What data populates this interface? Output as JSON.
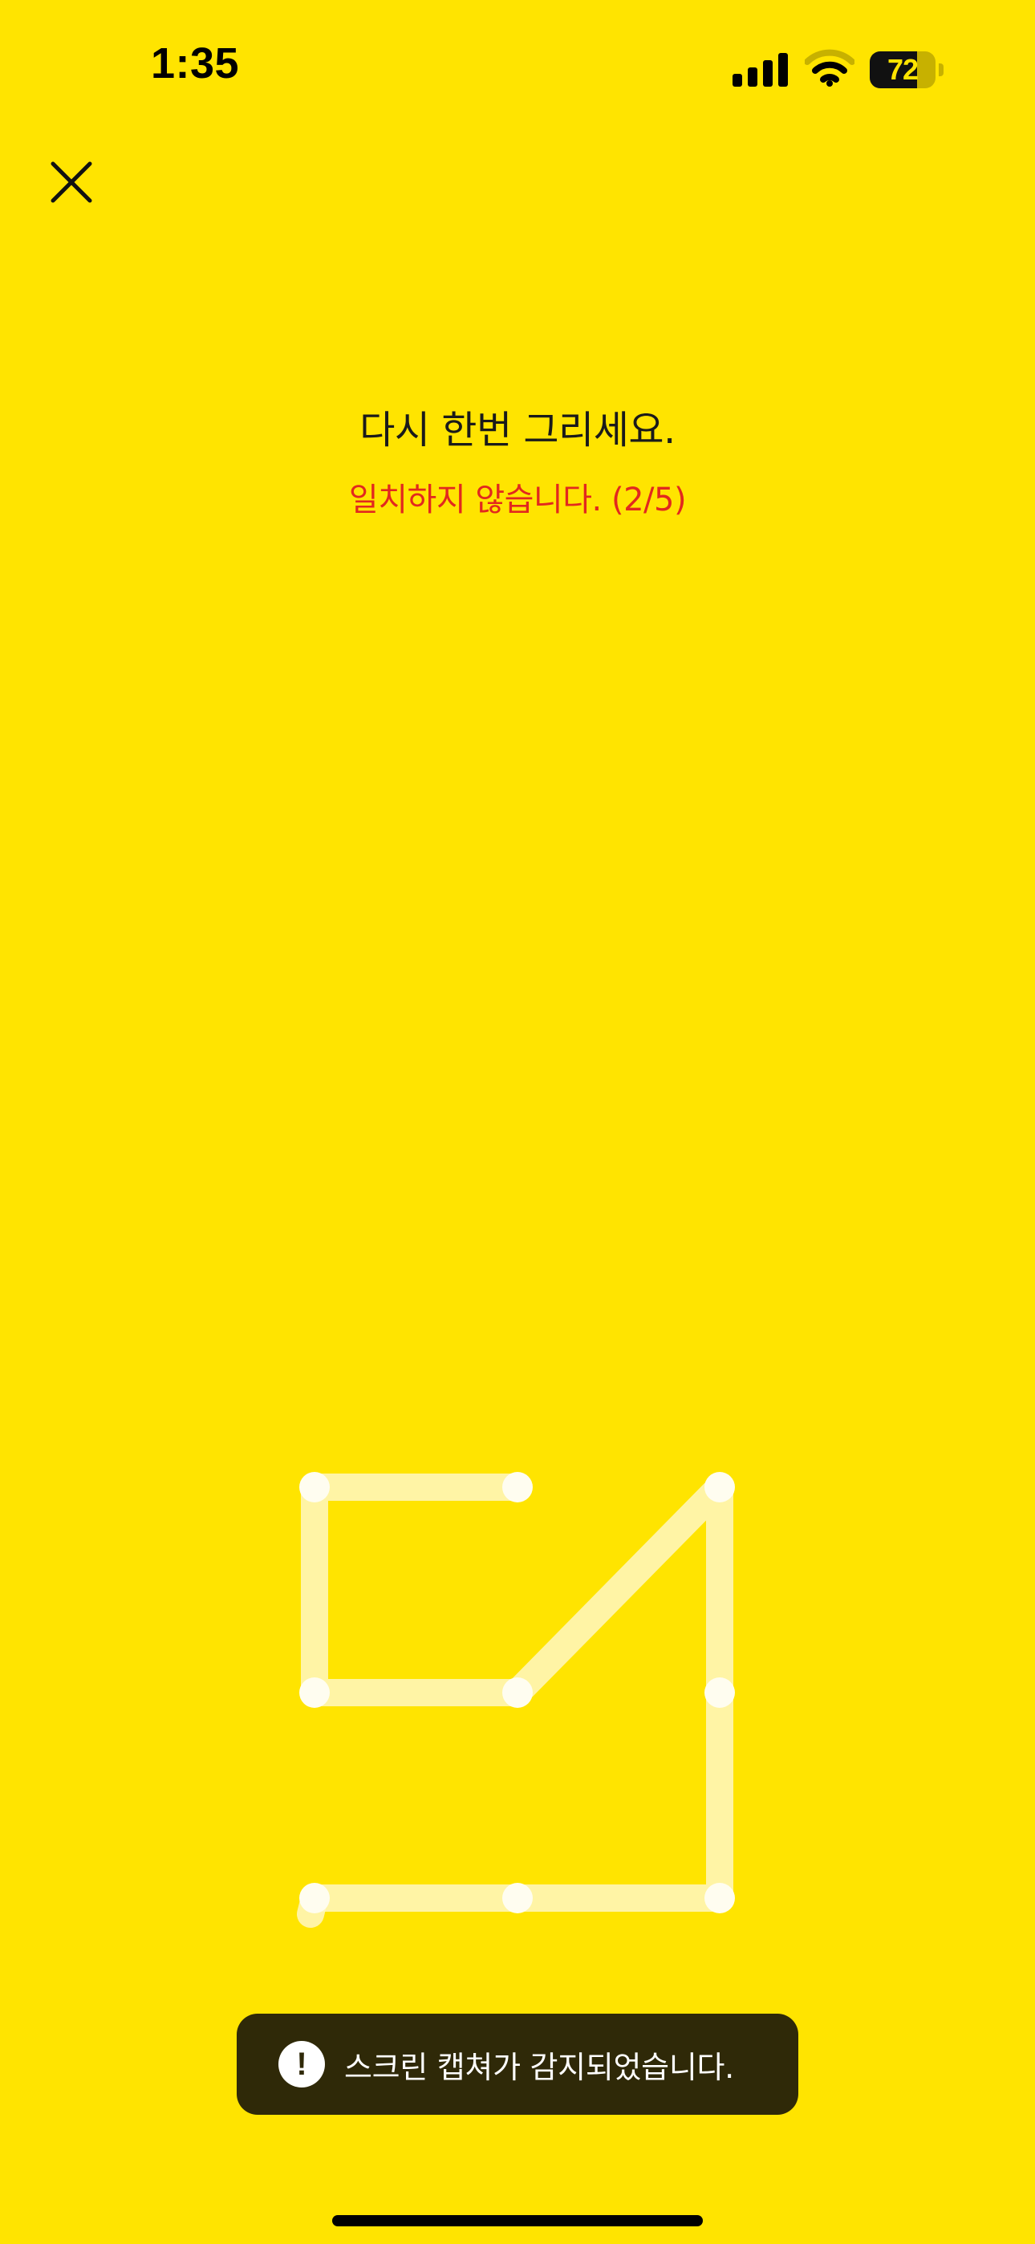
{
  "status_bar": {
    "time": "1:35",
    "battery_level": "72",
    "battery_fraction": 0.72
  },
  "close": {
    "icon": "close-icon"
  },
  "header": {
    "title": "다시 한번 그리세요.",
    "error": "일치하지 않습니다. (2/5)"
  },
  "pattern": {
    "grid_size": 3,
    "dots": [
      1,
      2,
      3,
      4,
      5,
      6,
      7,
      8,
      9
    ],
    "path": [
      2,
      1,
      4,
      5,
      3,
      6,
      9,
      8,
      7
    ],
    "colors": {
      "background": "#FFE400",
      "line": "#FFF7C2",
      "dot": "#FFFDF0"
    }
  },
  "toast": {
    "icon": "exclamation-icon",
    "text": "스크린 캡쳐가 감지되었습니다."
  },
  "colors": {
    "accent": "#FFE400",
    "error": "#e2281e",
    "toast_bg": "#2f2908"
  }
}
